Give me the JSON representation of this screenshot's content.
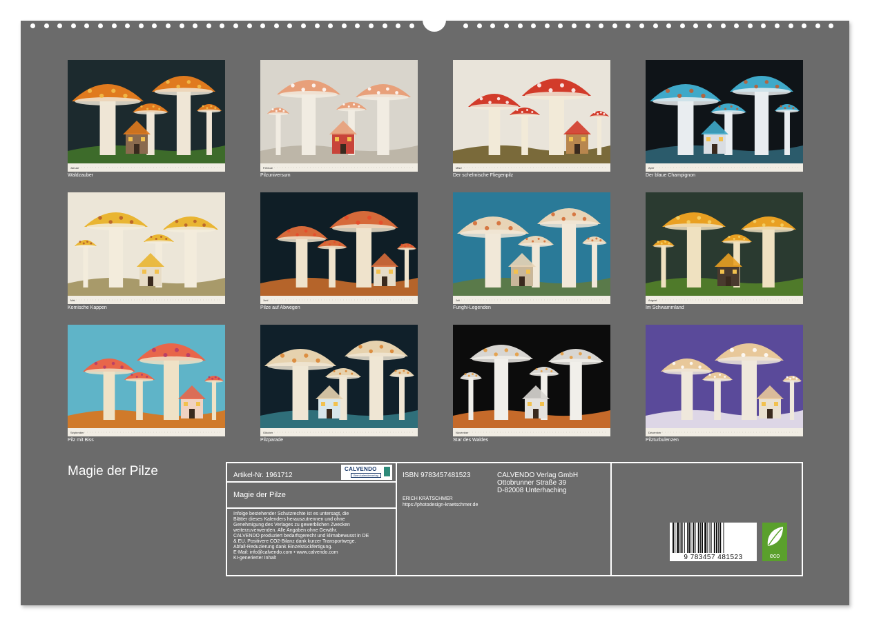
{
  "calendar": {
    "title": "Magie der Pilze",
    "months": [
      {
        "month_label": "Januar",
        "caption": "Waldzauber",
        "palette": {
          "sky": "#1c2a2e",
          "ground": "#3d6b2a",
          "cap": "#e07a1e",
          "stem": "#efe6d6",
          "house": "#8a6a4e",
          "accent": "#f2c14e"
        }
      },
      {
        "month_label": "Februar",
        "caption": "Pilzuniversum",
        "palette": {
          "sky": "#d9d5cc",
          "ground": "#bdb6a8",
          "cap": "#e8a07a",
          "stem": "#f1ece2",
          "house": "#c8443a",
          "accent": "#ffffff"
        }
      },
      {
        "month_label": "März",
        "caption": "Der schelmische Fliegenpilz",
        "palette": {
          "sky": "#e9e4da",
          "ground": "#7a6a3a",
          "cap": "#d23b2a",
          "stem": "#f2ead8",
          "house": "#b8864e",
          "accent": "#ffffff"
        }
      },
      {
        "month_label": "April",
        "caption": "Der blaue Champignon",
        "palette": {
          "sky": "#0f1418",
          "ground": "#2b5b6b",
          "cap": "#3fa9c9",
          "stem": "#e9edf0",
          "house": "#d9dde2",
          "accent": "#c65a2a"
        }
      },
      {
        "month_label": "Mai",
        "caption": "Komische Kappen",
        "palette": {
          "sky": "#ece6d8",
          "ground": "#a89a6a",
          "cap": "#e9b532",
          "stem": "#f3ecdc",
          "house": "#e7dcc6",
          "accent": "#b45a2a"
        }
      },
      {
        "month_label": "Juni",
        "caption": "Pilze auf Abwegen",
        "palette": {
          "sky": "#0f1e26",
          "ground": "#b5642a",
          "cap": "#d66a3a",
          "stem": "#efe3cc",
          "house": "#e6dcc8",
          "accent": "#e84a2a"
        }
      },
      {
        "month_label": "Juli",
        "caption": "Funghi-Legenden",
        "palette": {
          "sky": "#2a7a98",
          "ground": "#5a7a4a",
          "cap": "#e8d4b6",
          "stem": "#f1e8d8",
          "house": "#c9b79a",
          "accent": "#d2662e"
        }
      },
      {
        "month_label": "August",
        "caption": "Im Schwammland",
        "palette": {
          "sky": "#2a3a30",
          "ground": "#4f7a2a",
          "cap": "#e9a022",
          "stem": "#efe1c0",
          "house": "#4a3a2e",
          "accent": "#f6d36a"
        }
      },
      {
        "month_label": "September",
        "caption": "Pilz mit Biss",
        "palette": {
          "sky": "#5fb4c8",
          "ground": "#d07a2a",
          "cap": "#e8664a",
          "stem": "#efe2c6",
          "house": "#f0d2c2",
          "accent": "#b43a6a"
        }
      },
      {
        "month_label": "Oktober",
        "caption": "Pilzparade",
        "palette": {
          "sky": "#10202a",
          "ground": "#2f6f7a",
          "cap": "#e6d2ae",
          "stem": "#efe6d4",
          "house": "#d8e6ea",
          "accent": "#d9822e"
        }
      },
      {
        "month_label": "November",
        "caption": "Star des Waldes",
        "palette": {
          "sky": "#0c0c0c",
          "ground": "#c56a2a",
          "cap": "#d8d6d2",
          "stem": "#f1efea",
          "house": "#e4e2de",
          "accent": "#e69a3a"
        }
      },
      {
        "month_label": "Dezember",
        "caption": "Pilzturbulenzen",
        "palette": {
          "sky": "#5a4a9a",
          "ground": "#ddd6e6",
          "cap": "#e8c89a",
          "stem": "#efe8dc",
          "house": "#e9e0d0",
          "accent": "#ffffff"
        }
      }
    ]
  },
  "info": {
    "artikel": "Artikel-Nr. 1961712",
    "logo_text": "CALVENDO",
    "logo_subtext": "Bern kalenderverlag",
    "product_title": "Magie der Pilze",
    "legal_lines": [
      "Infolge bestehender Schutzrechte ist es untersagt, die",
      "Blätter dieses Kalenders herauszutrennen und ohne",
      "Genehmigung des Verlages zu gewerblichen Zwecken",
      "weiterzuverwenden. Alle Angaben ohne Gewähr.",
      "CALVENDO produziert bedarfsgerecht und klimabewusst in DE",
      "& EU. Positivere CO2-Bilanz dank kurzer Transportwege.",
      "Abfall-Reduzierung dank Einzelstückfertigung.",
      "E-Mail: info@calvendo.com • www.calvendo.com",
      "KI-generierter Inhalt"
    ],
    "isbn": "ISBN 9783457481523",
    "publisher_lines": [
      "CALVENDO Verlag GmbH",
      "Ottobrunner Straße 39",
      "D-82008 Unterhaching"
    ],
    "author": "ERICH KRÄTSCHMER",
    "website": "https://photodesign-kraetschmer.de",
    "barcode_number": "9 783457 481523",
    "eco_label": "eco"
  },
  "colors": {
    "board": "#6b6b6b",
    "line": "#ffffff",
    "eco_green": "#5aa02c"
  }
}
